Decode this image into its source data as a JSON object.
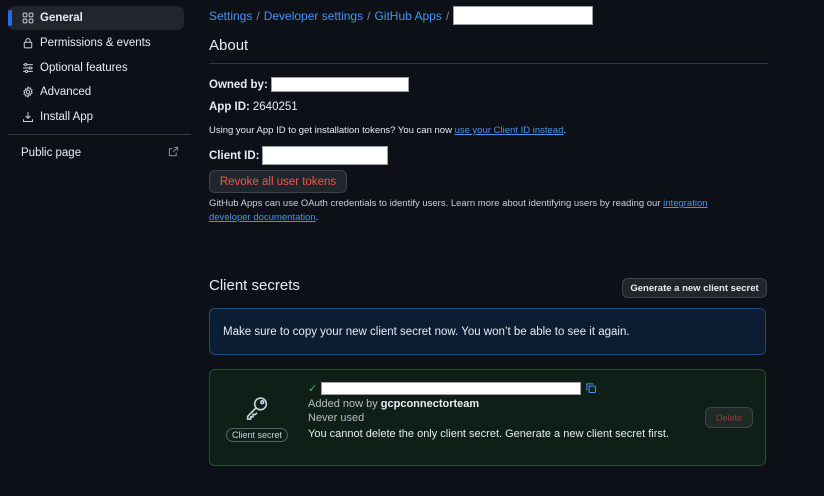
{
  "sidebar": {
    "items": [
      {
        "label": "General",
        "icon": "grid-icon",
        "active": true
      },
      {
        "label": "Permissions & events",
        "icon": "lock-icon"
      },
      {
        "label": "Optional features",
        "icon": "sliders-icon"
      },
      {
        "label": "Advanced",
        "icon": "gear-icon"
      },
      {
        "label": "Install App",
        "icon": "download-icon"
      }
    ],
    "public_page": "Public page"
  },
  "breadcrumb": {
    "settings": "Settings",
    "developer_settings": "Developer settings",
    "github_apps": "GitHub Apps",
    "separator": "/"
  },
  "about": {
    "title": "About",
    "owned_by_label": "Owned by:",
    "app_id_label": "App ID:",
    "app_id_value": "2640251",
    "app_id_note_prefix": "Using your App ID to get installation tokens? You can now",
    "app_id_note_link": "use your Client ID instead",
    "app_id_note_suffix": ".",
    "client_id_label": "Client ID:",
    "revoke_button": "Revoke all user tokens",
    "oauth_note_prefix": "GitHub Apps can use OAuth credentials to identify users. Learn more about identifying users by reading our",
    "oauth_note_link": "integration developer documentation",
    "oauth_note_suffix": "."
  },
  "client_secrets": {
    "title": "Client secrets",
    "generate_button": "Generate a new client secret",
    "flash": "Make sure to copy your new client secret now. You won’t be able to see it again.",
    "secret": {
      "badge": "Client secret",
      "added_prefix": "Added now by",
      "added_by": "gcpconnectorteam",
      "usage": "Never used",
      "warning": "You cannot delete the only client secret. Generate a new client secret first.",
      "delete_button": "Delete"
    }
  },
  "colors": {
    "background": "#0d1117",
    "accent": "#1f6feb",
    "link": "#4493f8",
    "danger": "#f85149",
    "success": "#3fb950"
  }
}
